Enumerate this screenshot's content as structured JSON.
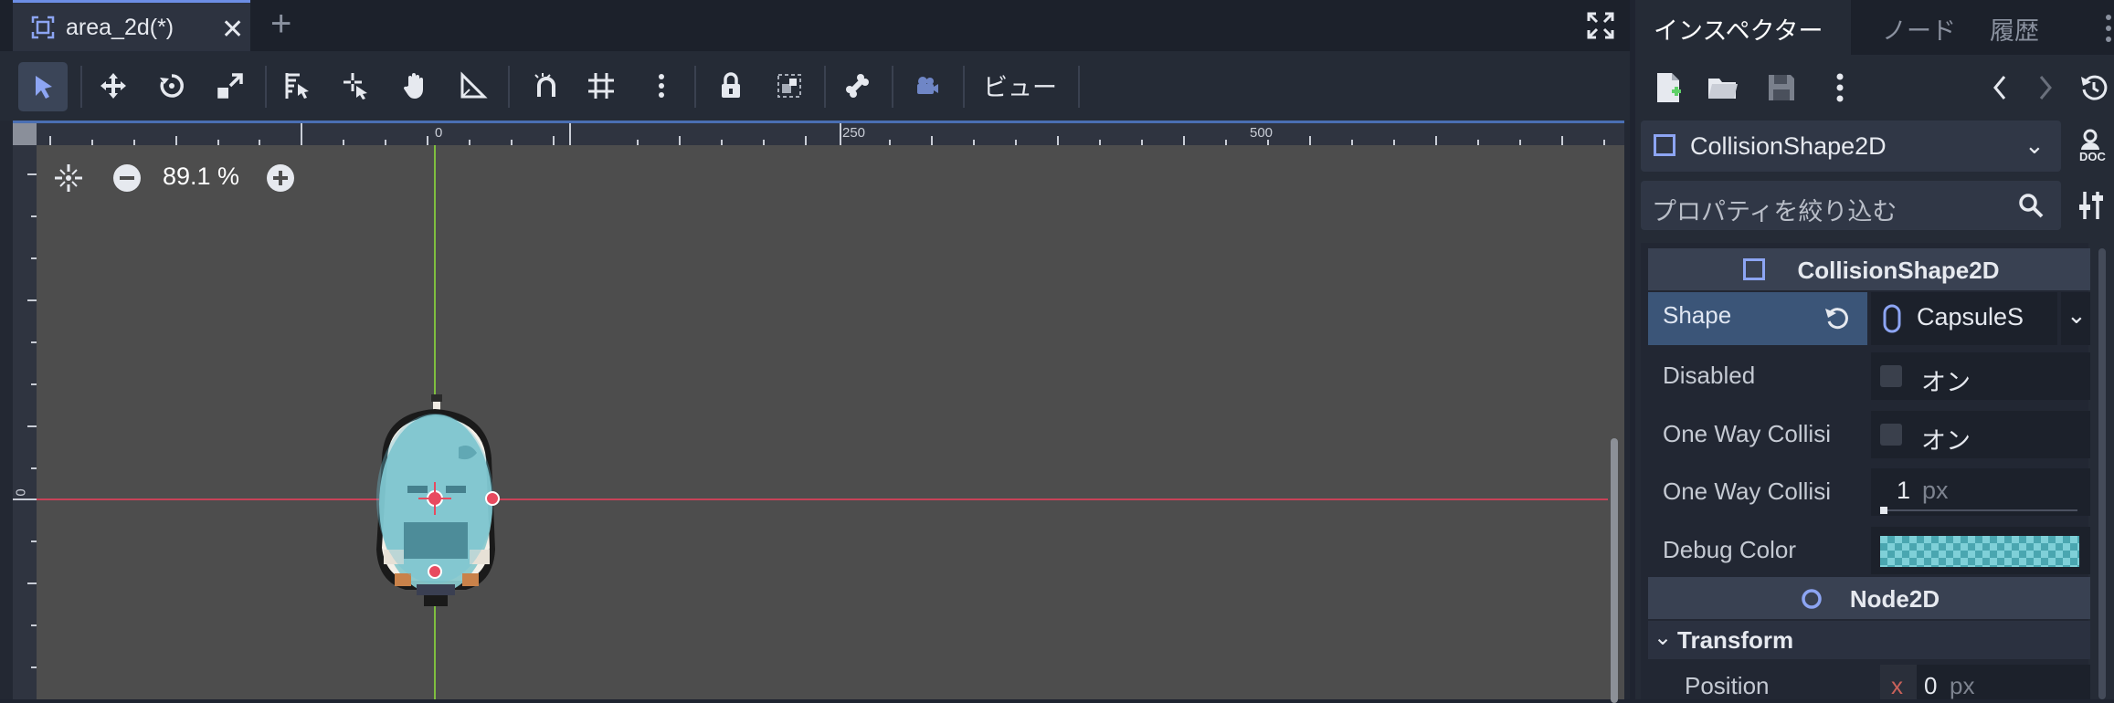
{
  "scene_tab": {
    "name": "area_2d(*)",
    "close": "✕",
    "add": "+"
  },
  "toolbar": {
    "view_label": "ビュー"
  },
  "viewport": {
    "zoom_label": "89.1 %",
    "ruler_labels": [
      "0",
      "250",
      "500"
    ],
    "left_ruler_label": "0"
  },
  "inspector": {
    "tabs": [
      "インスペクター",
      "ノード",
      "履歴"
    ],
    "node_name": "CollisionShape2D",
    "filter_placeholder": "プロパティを絞り込む",
    "sections": {
      "collision": "CollisionShape2D",
      "node2d": "Node2D",
      "transform": "Transform"
    },
    "props": {
      "shape_label": "Shape",
      "shape_value": "CapsuleS",
      "disabled_label": "Disabled",
      "disabled_value": "オン",
      "one_way_label": "One Way Collisi",
      "one_way_value": "オン",
      "one_way_margin_label": "One Way Collisi",
      "one_way_margin_value": "1",
      "one_way_margin_unit": "px",
      "debug_color_label": "Debug Color",
      "position_label": "Position",
      "position_x_axis": "x",
      "position_x": "0",
      "position_unit": "px"
    },
    "doc_label": "DOC"
  },
  "colors": {
    "accent": "#8da5f3",
    "axis_x": "#d04a5f",
    "axis_y": "#7fbf3f",
    "debug_color": "#7fd0d8"
  }
}
